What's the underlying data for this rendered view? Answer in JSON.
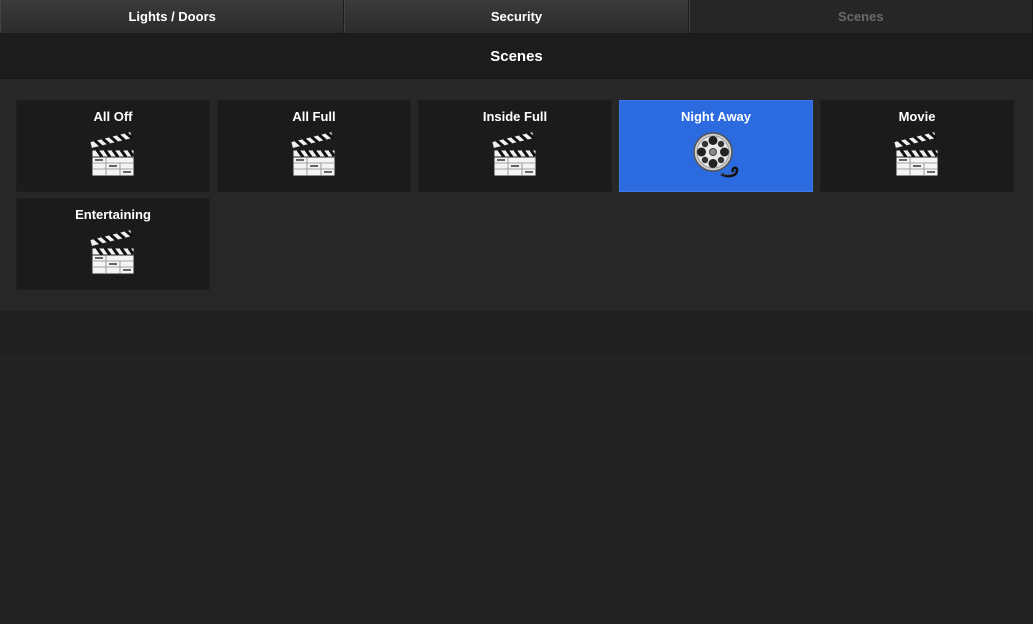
{
  "tabs": [
    {
      "label": "Lights / Doors",
      "active": false
    },
    {
      "label": "Security",
      "active": false
    },
    {
      "label": "Scenes",
      "active": true
    }
  ],
  "header": {
    "title": "Scenes"
  },
  "scenes": [
    {
      "label": "All Off",
      "icon": "clapperboard-icon",
      "selected": false
    },
    {
      "label": "All Full",
      "icon": "clapperboard-icon",
      "selected": false
    },
    {
      "label": "Inside Full",
      "icon": "clapperboard-icon",
      "selected": false
    },
    {
      "label": "Night Away",
      "icon": "film-reel-icon",
      "selected": true
    },
    {
      "label": "Movie",
      "icon": "clapperboard-icon",
      "selected": false
    },
    {
      "label": "Entertaining",
      "icon": "clapperboard-icon",
      "selected": false
    }
  ],
  "colors": {
    "selected_tile": "#2c6ae0",
    "tile": "#1b1b1b",
    "background": "#232323",
    "active_tab_text": "#6a6a6a"
  }
}
